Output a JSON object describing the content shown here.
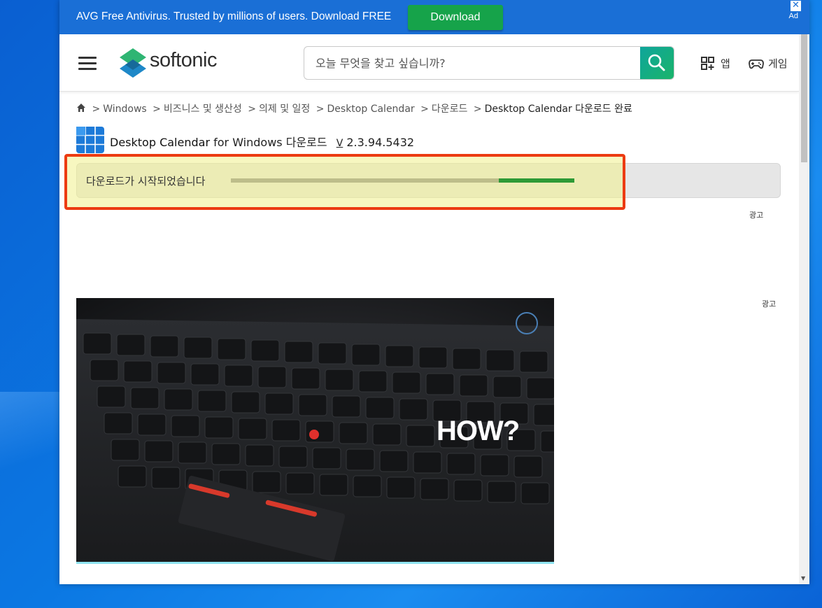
{
  "ad": {
    "text": "AVG Free Antivirus. Trusted by millions of users. Download FREE",
    "button": "Download",
    "close": "✕",
    "label": "Ad"
  },
  "header": {
    "logo_text": "softonic",
    "search_placeholder": "오늘 무엇을 찾고 싶습니까?",
    "apps_label": "앱",
    "games_label": "게임"
  },
  "breadcrumb": {
    "sep": ">",
    "items": [
      "Windows",
      "비즈니스 및 생산성",
      "의제 및 일정",
      "Desktop Calendar",
      "다운로드"
    ],
    "current": "Desktop Calendar 다운로드 완료"
  },
  "app": {
    "name": "Desktop Calendar",
    "suffix": "for Windows 다운로드",
    "version_prefix": "V",
    "version": "2.3.94.5432"
  },
  "download": {
    "status": "다운로드가 시작되었습니다",
    "progress_start": 0.78,
    "progress_end": 1.0
  },
  "ads": {
    "label_1": "광고",
    "label_2": "광고"
  },
  "hero": {
    "overlay_text": "HOW?"
  },
  "colors": {
    "ad_banner": "#1a6fd6",
    "download_button": "#16a34a",
    "highlight_border": "#ec3b12",
    "progress_fill": "#2e9a36"
  }
}
